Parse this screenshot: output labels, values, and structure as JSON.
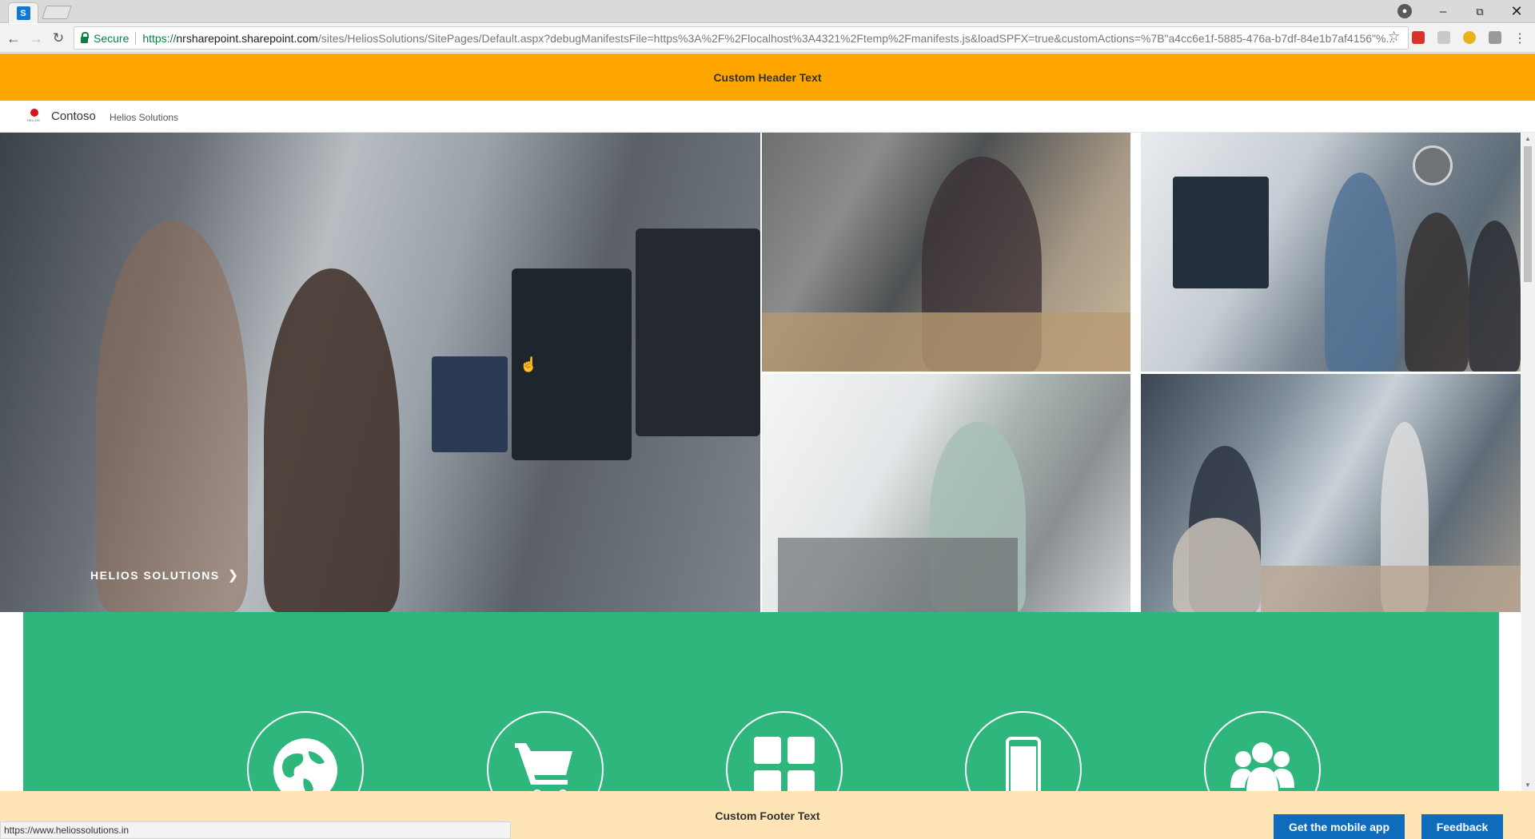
{
  "browser": {
    "tab_favicon_letter": "S",
    "secure_label": "Secure",
    "url_protocol": "https://",
    "url_host": "nrsharepoint.sharepoint.com",
    "url_rest": "/sites/HeliosSolutions/SitePages/Default.aspx?debugManifestsFile=https%3A%2F%2Flocalhost%3A4321%2Ftemp%2Fmanifests.js&loadSPFX=true&customActions=%7B\"a4cc6e1f-5885-476a-b7df-84e1b7af4156\"%...",
    "status_url": "https://www.heliossolutions.in"
  },
  "page": {
    "header_text": "Custom Header Text",
    "brand": "Contoso",
    "site_name": "Helios Solutions",
    "logo_text": "HELIOS",
    "hero_label": "HELIOS SOLUTIONS",
    "footer_text": "Custom Footer Text",
    "mobile_button": "Get the mobile app",
    "feedback_button": "Feedback"
  },
  "colors": {
    "header": "#ffa500",
    "band": "#2eb67d",
    "footer": "#ffe4b5",
    "button": "#0f6cbd"
  },
  "icons": [
    "globe-icon",
    "shopping-cart-icon",
    "grid-icon",
    "mobile-icon",
    "people-icon"
  ]
}
